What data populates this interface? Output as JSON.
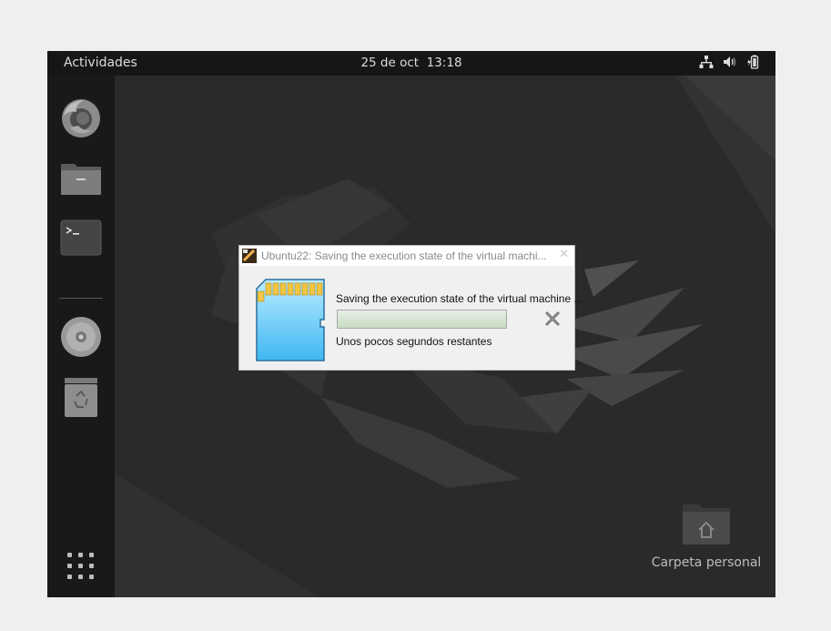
{
  "topbar": {
    "activities": "Actividades",
    "clock_date": "25 de oct",
    "clock_time": "13:18",
    "tray_icons": [
      "network-wired-icon",
      "volume-icon",
      "battery-icon"
    ]
  },
  "dock": {
    "items": [
      {
        "name": "firefox",
        "icon": "firefox-icon"
      },
      {
        "name": "files",
        "icon": "folder-icon"
      },
      {
        "name": "terminal",
        "icon": "terminal-icon"
      },
      {
        "name": "optical-disc",
        "icon": "disc-icon"
      },
      {
        "name": "trash",
        "icon": "trash-icon"
      }
    ],
    "apps_grid_icon": "grid-icon"
  },
  "desktop": {
    "home_folder_label": "Carpeta personal"
  },
  "dialog": {
    "title": "Ubuntu22: Saving the execution state of the virtual machi...",
    "operation_text": "Saving the execution state of the virtual machine ...",
    "remaining_text": "Unos pocos segundos restantes",
    "progress_fraction": 1.0
  },
  "colors": {
    "topbar": "#161616",
    "dock": "#191919",
    "desktop": "#2b2b2b",
    "progress_fill": "#c7dcc2",
    "sdcard": "#5ec6f5"
  }
}
